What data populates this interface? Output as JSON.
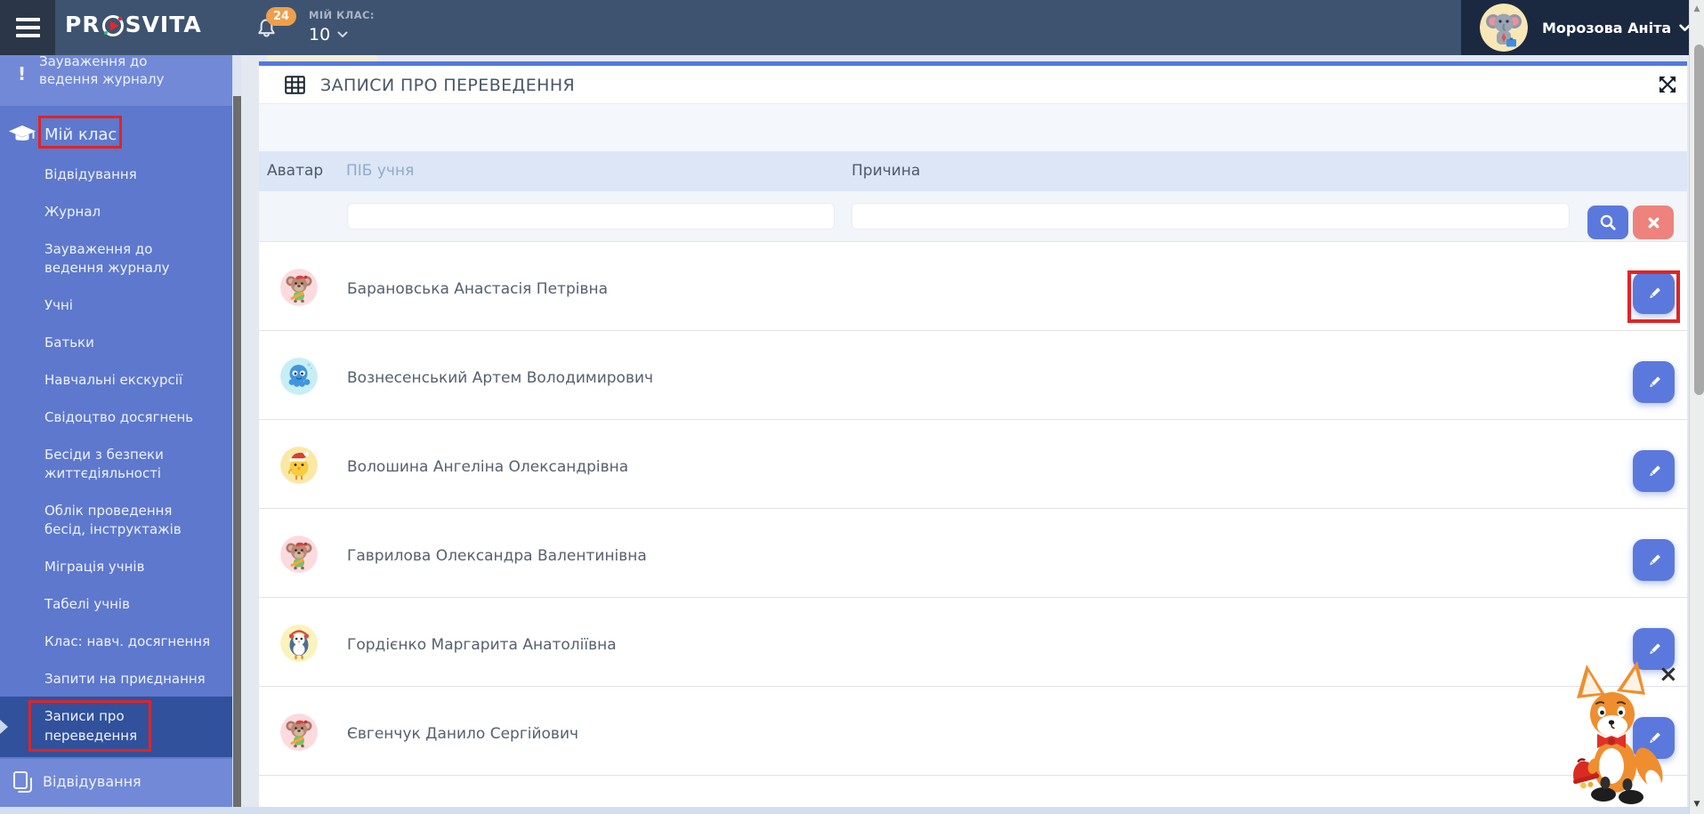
{
  "header": {
    "logo_left": "PR",
    "logo_right": "SVITA",
    "notifications_badge": "24",
    "class_label": "МІЙ КЛАС:",
    "class_value": "10",
    "user_name": "Морозова Аніта"
  },
  "sidebar": {
    "top_item": {
      "icon": "!",
      "label": "Зауваження до\nведення журналу"
    },
    "section_label": "Мій клас",
    "items": [
      "Відвідування",
      "Журнал",
      "Зауваження до\nведення журналу",
      "Учні",
      "Батьки",
      "Навчальні екскурсії",
      "Свідоцтво досягнень",
      "Бесіди з безпеки\nжиттєдіяльності",
      "Облік проведення\nбесід, інструктажів",
      "Міграція учнів",
      "Табелі учнів",
      "Клас: навч. досягнення",
      "Запити на приєднання"
    ],
    "selected_item": "Записи про\nпереведення",
    "bottom_item": "Відвідування"
  },
  "main": {
    "title": "ЗАПИСИ ПРО ПЕРЕВЕДЕННЯ",
    "columns": {
      "avatar": "Аватар",
      "name": "ПІБ учня",
      "reason": "Причина"
    },
    "filters": {
      "name_value": "",
      "reason_value": ""
    },
    "rows": [
      {
        "name": "Барановська Анастасія Петрівна",
        "avatar": "koala",
        "reason": ""
      },
      {
        "name": "Вознесенський Артем Володимирович",
        "avatar": "octopus",
        "reason": ""
      },
      {
        "name": "Волошина Ангеліна Олександрівна",
        "avatar": "chick",
        "reason": ""
      },
      {
        "name": "Гаврилова Олександра Валентинівна",
        "avatar": "koala",
        "reason": ""
      },
      {
        "name": "Гордієнко Маргарита Анатоліївна",
        "avatar": "penguin",
        "reason": ""
      },
      {
        "name": "Євгенчук Данило Сергійович",
        "avatar": "koala",
        "reason": ""
      }
    ]
  },
  "icons": {
    "hamburger": "menu-icon",
    "bell": "notifications-bell-icon",
    "logo_play": "play-circle-icon",
    "chevron": "chevron-down-icon",
    "grad_cap": "graduation-cap-icon",
    "pages": "pages-icon",
    "grid": "table-grid-icon",
    "fullscreen": "expand-arrows-icon",
    "search": "magnifier-icon",
    "clear": "x-icon",
    "edit": "pencil-icon",
    "close": "close-x-icon"
  },
  "colors": {
    "header": "#3e5370",
    "header_dark": "#1b2940",
    "sidebar": "#5d78cd",
    "sidebar_light": "#7289d8",
    "sidebar_selected": "#31519c",
    "accent_blue": "#5b79dd",
    "clear_red": "#ee827d",
    "badge_orange": "#ef9f4b",
    "annotation_red": "#e02424",
    "table_head_bg": "#dce6f7"
  }
}
